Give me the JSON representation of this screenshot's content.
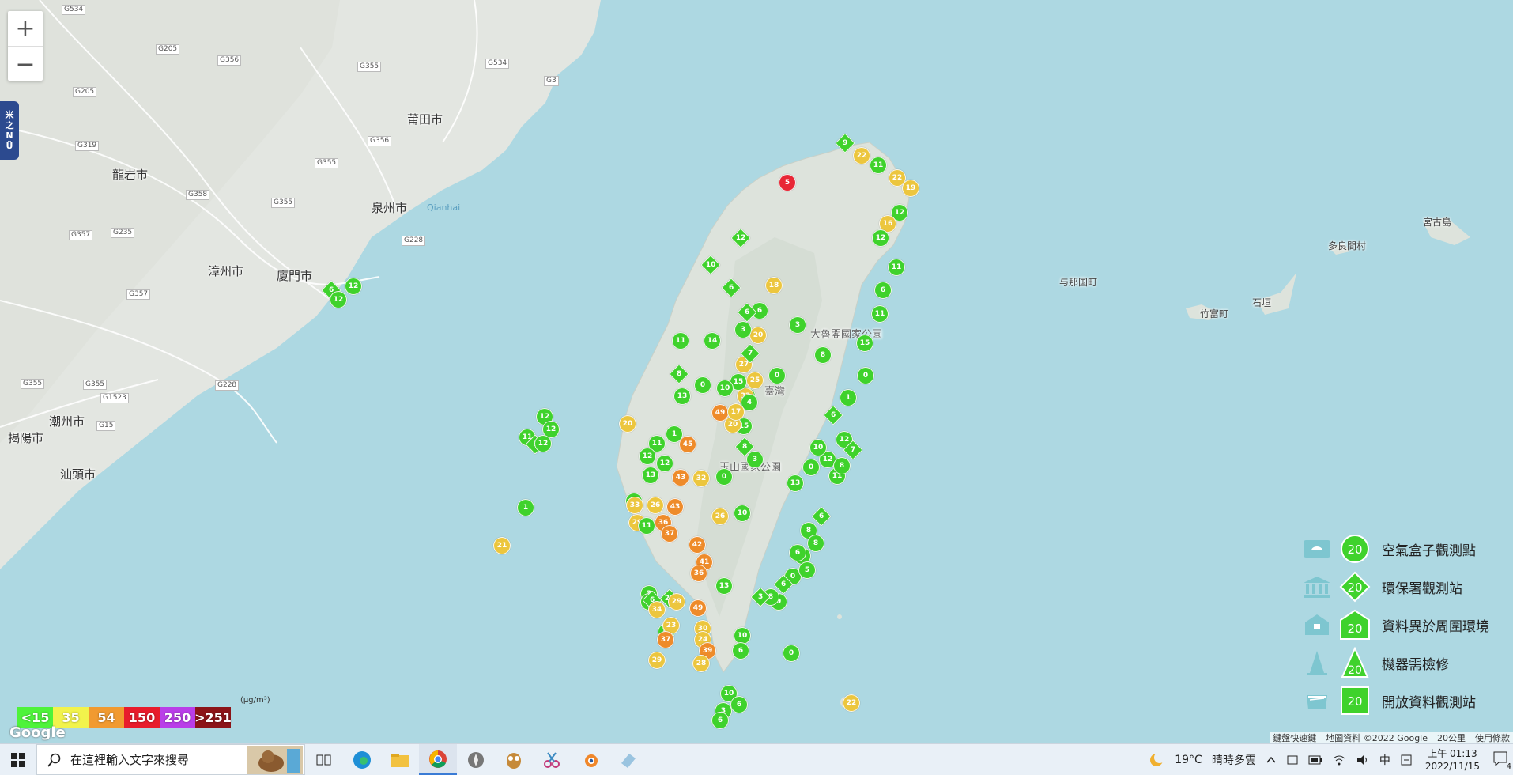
{
  "map": {
    "zoom_in": "+",
    "zoom_out": "−",
    "side_tab": [
      "米",
      "之",
      "N",
      "Ü"
    ],
    "city_labels": [
      "莆田市",
      "龍岩市",
      "泉州市",
      "漳州市",
      "廈門市",
      "潮州市",
      "揭陽市",
      "汕頭市",
      "宮古島",
      "多良間村",
      "与那国町",
      "竹富町",
      "石垣"
    ],
    "water_label": "Qianhai",
    "park_labels": [
      "大魯閣國家公園",
      "玉山國家公園",
      "臺灣"
    ],
    "road_labels": [
      "G534",
      "G205",
      "G356",
      "G355",
      "G534",
      "G3",
      "G205",
      "G319",
      "G356",
      "G355",
      "G358",
      "G355",
      "G228",
      "G357",
      "G235",
      "G357",
      "G355",
      "G1523",
      "G15",
      "G228",
      "G355"
    ]
  },
  "aqi_scale": {
    "unit": "(μg/m³)",
    "items": [
      {
        "label": "<15",
        "color": "#4ef33a"
      },
      {
        "label": "35",
        "color": "#f2f34c"
      },
      {
        "label": "54",
        "color": "#f19a30"
      },
      {
        "label": "150",
        "color": "#e81c2c"
      },
      {
        "label": "250",
        "color": "#b93ee8"
      },
      {
        "label": ">251",
        "color": "#8c1418"
      }
    ]
  },
  "legend": {
    "badge_value": "20",
    "rows": [
      {
        "label": "空氣盒子觀測點",
        "shape": "circle"
      },
      {
        "label": "環保署觀測站",
        "shape": "diamond"
      },
      {
        "label": "資料異於周圍環境",
        "shape": "pentagon"
      },
      {
        "label": "機器需檢修",
        "shape": "triangle"
      },
      {
        "label": "開放資料觀測站",
        "shape": "square"
      }
    ]
  },
  "attribution": {
    "shortcuts": "鍵盤快速鍵",
    "map_data": "地圖資料 ©2022 Google",
    "scale": "20公里",
    "terms": "使用條款"
  },
  "google_logo": "Google",
  "taskbar": {
    "search_placeholder": "在這裡輸入文字來搜尋",
    "weather_temp": "19°C",
    "weather_text": "晴時多雲",
    "ime": "中",
    "time": "上午 01:13",
    "date": "2022/11/15",
    "notification_count": "4"
  },
  "markers": [
    {
      "v": "6",
      "c": "g",
      "s": "d"
    },
    {
      "v": "12",
      "c": "g",
      "s": "c"
    },
    {
      "v": "12",
      "c": "g",
      "s": "c"
    },
    {
      "v": "12",
      "c": "g",
      "s": "c"
    },
    {
      "v": "11",
      "c": "g",
      "s": "c"
    },
    {
      "v": "12",
      "c": "g",
      "s": "c"
    },
    {
      "v": "1",
      "c": "g",
      "s": "d"
    },
    {
      "v": "12",
      "c": "g",
      "s": "c"
    },
    {
      "v": "1",
      "c": "g",
      "s": "c"
    },
    {
      "v": "21",
      "c": "y",
      "s": "c"
    },
    {
      "v": "9",
      "c": "g",
      "s": "d"
    },
    {
      "v": "22",
      "c": "y",
      "s": "c"
    },
    {
      "v": "11",
      "c": "g",
      "s": "c"
    },
    {
      "v": "22",
      "c": "y",
      "s": "c"
    },
    {
      "v": "19",
      "c": "y",
      "s": "c"
    },
    {
      "v": "12",
      "c": "g",
      "s": "c"
    },
    {
      "v": "16",
      "c": "y",
      "s": "c"
    },
    {
      "v": "12",
      "c": "g",
      "s": "c"
    },
    {
      "v": "11",
      "c": "g",
      "s": "c"
    },
    {
      "v": "6",
      "c": "g",
      "s": "c"
    },
    {
      "v": "11",
      "c": "g",
      "s": "c"
    },
    {
      "v": "15",
      "c": "g",
      "s": "c"
    },
    {
      "v": "0",
      "c": "g",
      "s": "c"
    },
    {
      "v": "1",
      "c": "g",
      "s": "c"
    },
    {
      "v": "8",
      "c": "g",
      "s": "c"
    },
    {
      "v": "3",
      "c": "g",
      "s": "c"
    },
    {
      "v": "0",
      "c": "g",
      "s": "c"
    },
    {
      "v": "20",
      "c": "y",
      "s": "c"
    },
    {
      "v": "3",
      "c": "g",
      "s": "c"
    },
    {
      "v": "13",
      "c": "g",
      "s": "c"
    },
    {
      "v": "15",
      "c": "g",
      "s": "c"
    },
    {
      "v": "8",
      "c": "g",
      "s": "d"
    },
    {
      "v": "3",
      "c": "g",
      "s": "c"
    },
    {
      "v": "6",
      "c": "g",
      "s": "d"
    },
    {
      "v": "12",
      "c": "g",
      "s": "c"
    },
    {
      "v": "7",
      "c": "g",
      "s": "d"
    },
    {
      "v": "0",
      "c": "g",
      "s": "c"
    },
    {
      "v": "49",
      "c": "o",
      "s": "c"
    },
    {
      "v": "20",
      "c": "y",
      "s": "c"
    },
    {
      "v": "45",
      "c": "o",
      "s": "c"
    },
    {
      "v": "43",
      "c": "o",
      "s": "c"
    },
    {
      "v": "32",
      "c": "y",
      "s": "c"
    },
    {
      "v": "0",
      "c": "g",
      "s": "c"
    },
    {
      "v": "10",
      "c": "g",
      "s": "c"
    },
    {
      "v": "43",
      "c": "o",
      "s": "c"
    },
    {
      "v": "36",
      "c": "o",
      "s": "c"
    },
    {
      "v": "37",
      "c": "o",
      "s": "c"
    },
    {
      "v": "26",
      "c": "y",
      "s": "c"
    },
    {
      "v": "42",
      "c": "o",
      "s": "c"
    },
    {
      "v": "41",
      "c": "o",
      "s": "c"
    },
    {
      "v": "36",
      "c": "o",
      "s": "c"
    },
    {
      "v": "13",
      "c": "g",
      "s": "c"
    },
    {
      "v": "49",
      "c": "o",
      "s": "c"
    },
    {
      "v": "30",
      "c": "y",
      "s": "c"
    },
    {
      "v": "24",
      "c": "y",
      "s": "c"
    },
    {
      "v": "39",
      "c": "o",
      "s": "c"
    },
    {
      "v": "28",
      "c": "y",
      "s": "c"
    },
    {
      "v": "29",
      "c": "y",
      "s": "c"
    },
    {
      "v": "10",
      "c": "g",
      "s": "c"
    },
    {
      "v": "6",
      "c": "g",
      "s": "c"
    },
    {
      "v": "10",
      "c": "g",
      "s": "c"
    },
    {
      "v": "6",
      "c": "g",
      "s": "c"
    },
    {
      "v": "3",
      "c": "g",
      "s": "c"
    },
    {
      "v": "6",
      "c": "g",
      "s": "c"
    },
    {
      "v": "0",
      "c": "g",
      "s": "c"
    },
    {
      "v": "6",
      "c": "g",
      "s": "c"
    },
    {
      "v": "0",
      "c": "g",
      "s": "c"
    },
    {
      "v": "5",
      "c": "g",
      "s": "c"
    },
    {
      "v": "13",
      "c": "g",
      "s": "c"
    },
    {
      "v": "12",
      "c": "g",
      "s": "c"
    },
    {
      "v": "11",
      "c": "g",
      "s": "c"
    },
    {
      "v": "8",
      "c": "g",
      "s": "c"
    },
    {
      "v": "6",
      "c": "g",
      "s": "d"
    },
    {
      "v": "8",
      "c": "g",
      "s": "c"
    },
    {
      "v": "8",
      "c": "g",
      "s": "c"
    },
    {
      "v": "6",
      "c": "g",
      "s": "c"
    },
    {
      "v": "6",
      "c": "g",
      "s": "d"
    },
    {
      "v": "0",
      "c": "g",
      "s": "c"
    },
    {
      "v": "8",
      "c": "g",
      "s": "c"
    },
    {
      "v": "3",
      "c": "g",
      "s": "d"
    },
    {
      "v": "10",
      "c": "g",
      "s": "c"
    },
    {
      "v": "6",
      "c": "g",
      "s": "c"
    },
    {
      "v": "18",
      "c": "y",
      "s": "c"
    },
    {
      "v": "25",
      "c": "y",
      "s": "c"
    },
    {
      "v": "27",
      "c": "y",
      "s": "c"
    },
    {
      "v": "32",
      "c": "y",
      "s": "c"
    },
    {
      "v": "15",
      "c": "g",
      "s": "c"
    },
    {
      "v": "4",
      "c": "g",
      "s": "c"
    },
    {
      "v": "17",
      "c": "y",
      "s": "c"
    },
    {
      "v": "10",
      "c": "g",
      "s": "c"
    },
    {
      "v": "11",
      "c": "g",
      "s": "c"
    },
    {
      "v": "12",
      "c": "g",
      "s": "c"
    },
    {
      "v": "20",
      "c": "y",
      "s": "c"
    },
    {
      "v": "29",
      "c": "y",
      "s": "c"
    },
    {
      "v": "12",
      "c": "g",
      "s": "c"
    },
    {
      "v": "33",
      "c": "y",
      "s": "c"
    },
    {
      "v": "26",
      "c": "y",
      "s": "c"
    },
    {
      "v": "7",
      "c": "g",
      "s": "d"
    },
    {
      "v": "6",
      "c": "g",
      "s": "d"
    },
    {
      "v": "12",
      "c": "g",
      "s": "d"
    },
    {
      "v": "6",
      "c": "g",
      "s": "d"
    },
    {
      "v": "10",
      "c": "g",
      "s": "d"
    },
    {
      "v": "11",
      "c": "g",
      "s": "c"
    },
    {
      "v": "8",
      "c": "g",
      "s": "d"
    },
    {
      "v": "13",
      "c": "g",
      "s": "c"
    },
    {
      "v": "14",
      "c": "g",
      "s": "c"
    },
    {
      "v": "0",
      "c": "g",
      "s": "c"
    },
    {
      "v": "1",
      "c": "g",
      "s": "c"
    },
    {
      "v": "12",
      "c": "g",
      "s": "c"
    },
    {
      "v": "13",
      "c": "g",
      "s": "c"
    },
    {
      "v": "11",
      "c": "g",
      "s": "c"
    },
    {
      "v": "3",
      "c": "g",
      "s": "c"
    },
    {
      "v": "20",
      "c": "g",
      "s": "d"
    },
    {
      "v": "12",
      "c": "g",
      "s": "c"
    },
    {
      "v": "10",
      "c": "g",
      "s": "c"
    },
    {
      "v": "6",
      "c": "g",
      "s": "d"
    },
    {
      "v": "23",
      "c": "y",
      "s": "c"
    },
    {
      "v": "34",
      "c": "y",
      "s": "c"
    },
    {
      "v": "37",
      "c": "o",
      "s": "c"
    },
    {
      "v": "29",
      "c": "y",
      "s": "c"
    },
    {
      "v": "22",
      "c": "y",
      "s": "c"
    },
    {
      "v": "5",
      "c": "r",
      "s": "c"
    }
  ]
}
